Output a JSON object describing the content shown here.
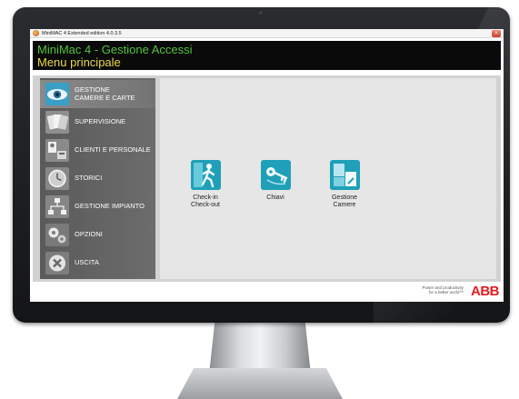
{
  "window": {
    "title": "MiniMAC 4  Extended edition 4.0.3.5",
    "close_glyph": "×"
  },
  "header": {
    "title": "MiniMac 4 - Gestione Accessi",
    "subtitle": "Menu principale"
  },
  "sidebar": {
    "items": [
      {
        "label_line1": "GESTIONE",
        "label_line2": "CAMERE E CARTE",
        "icon": "eye-icon",
        "active": true
      },
      {
        "label": "SUPERVISIONE",
        "icon": "cards-icon"
      },
      {
        "label": "CLIENTI E PERSONALE",
        "icon": "people-icon"
      },
      {
        "label": "STORICI",
        "icon": "clock-icon"
      },
      {
        "label": "GESTIONE IMPIANTO",
        "icon": "network-icon"
      },
      {
        "label": "OPZIONI",
        "icon": "gears-icon"
      },
      {
        "label": "USCITA",
        "icon": "exit-icon"
      }
    ]
  },
  "main": {
    "tiles": [
      {
        "label_line1": "Check-in",
        "label_line2": "Check-out",
        "icon": "walking-person-icon"
      },
      {
        "label_line1": "Chiavi",
        "label_line2": "",
        "icon": "keys-icon"
      },
      {
        "label_line1": "Gestione",
        "label_line2": "Camere",
        "icon": "rooms-icon"
      }
    ]
  },
  "footer": {
    "tagline_line1": "Power and productivity",
    "tagline_line2": "for a better world™",
    "brand": "ABB"
  },
  "colors": {
    "header_title": "#54c23e",
    "header_subtitle": "#e8d84b",
    "tile_accent": "#1b93ad",
    "brand_red": "#e21c21"
  }
}
